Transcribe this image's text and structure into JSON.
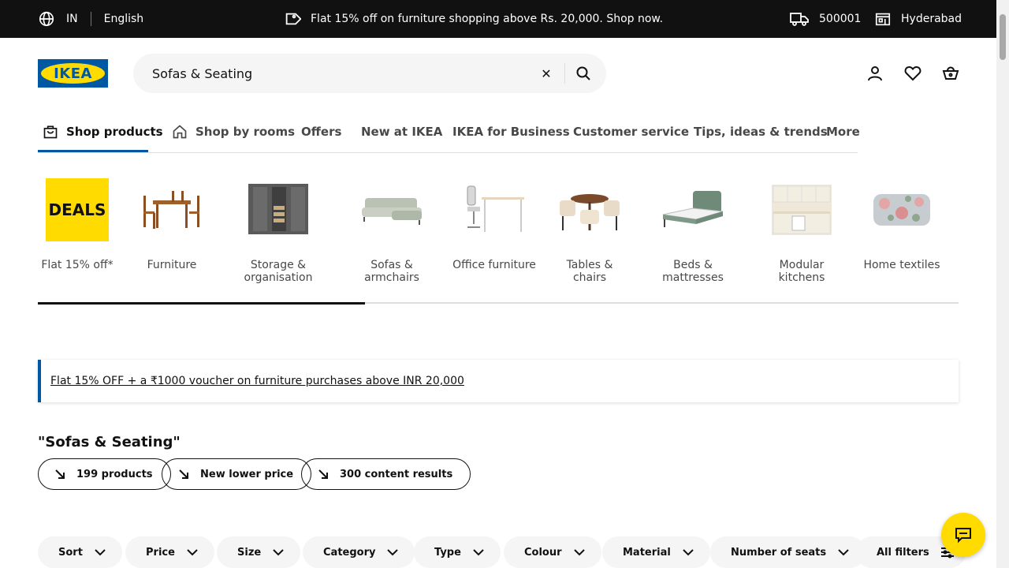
{
  "topbar": {
    "country": "IN",
    "language": "English",
    "promo": "Flat 15% off on furniture shopping above Rs. 20,000. Shop now.",
    "pincode": "500001",
    "store": "Hyderabad"
  },
  "header": {
    "logo_text": "IKEA",
    "search_value": "Sofas & Seating"
  },
  "nav": {
    "tabs": [
      {
        "label": "Shop products"
      },
      {
        "label": "Shop by rooms"
      },
      {
        "label": "Offers"
      },
      {
        "label": "New at IKEA"
      },
      {
        "label": "IKEA for Business"
      },
      {
        "label": "Customer service"
      },
      {
        "label": "Tips, ideas & trends"
      },
      {
        "label": "More"
      }
    ]
  },
  "categories": {
    "deals_badge": "DEALS",
    "items": [
      {
        "label": "Flat 15% off*"
      },
      {
        "label": "Furniture"
      },
      {
        "label": "Storage & organisation"
      },
      {
        "label": "Sofas & armchairs"
      },
      {
        "label": "Office furniture"
      },
      {
        "label": "Tables & chairs"
      },
      {
        "label": "Beds & mattresses"
      },
      {
        "label": "Modular kitchens"
      },
      {
        "label": "Home textiles"
      }
    ],
    "scroll_progress_fraction": 0.355
  },
  "promo_banner": {
    "text": "Flat 15% OFF + a ₹1000 voucher on furniture purchases above INR 20,000"
  },
  "results": {
    "title": "\"Sofas & Seating\"",
    "chips": [
      {
        "label": "199 products"
      },
      {
        "label": "New lower price"
      },
      {
        "label": "300 content results"
      }
    ]
  },
  "filters": [
    {
      "label": "Sort"
    },
    {
      "label": "Price"
    },
    {
      "label": "Size"
    },
    {
      "label": "Category"
    },
    {
      "label": "Type"
    },
    {
      "label": "Colour"
    },
    {
      "label": "Material"
    },
    {
      "label": "Number of seats"
    },
    {
      "label": "All filters"
    }
  ],
  "colors": {
    "ikea_blue": "#0058a3",
    "ikea_yellow": "#ffdb00",
    "topbar_bg": "#111111"
  }
}
